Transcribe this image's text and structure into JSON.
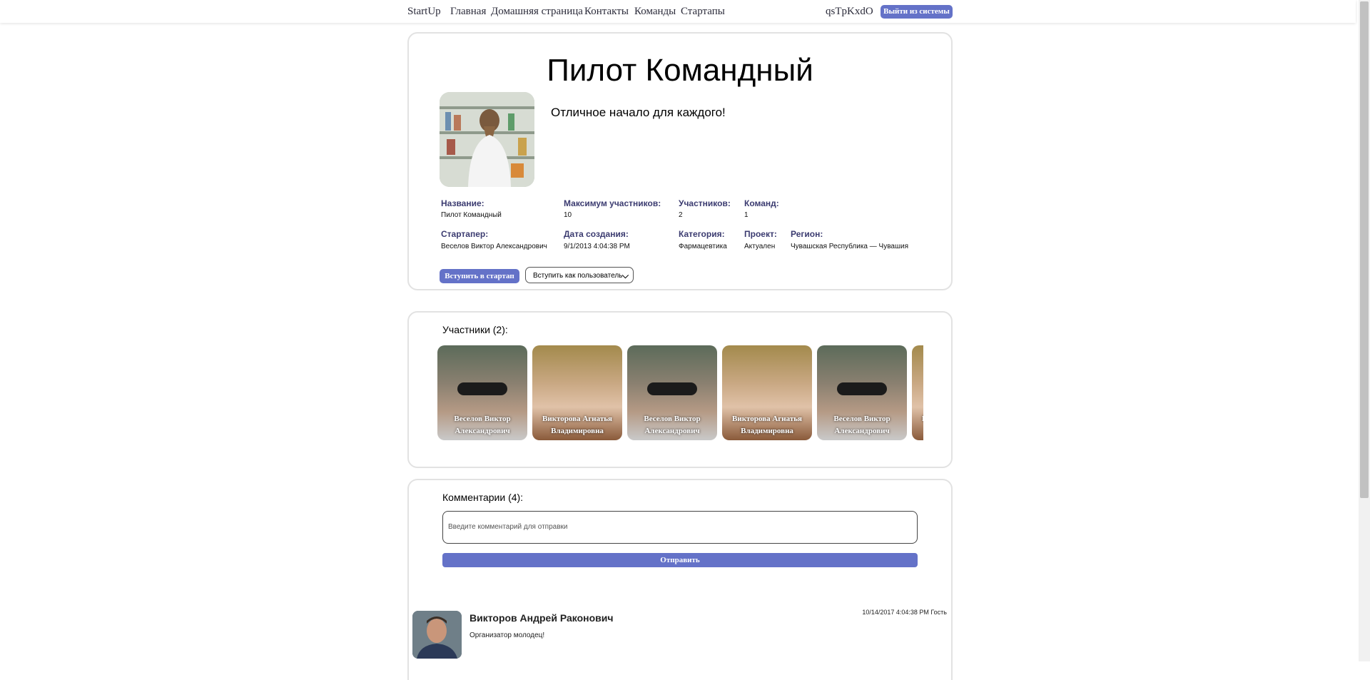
{
  "nav": {
    "brand": "StartUp",
    "links": [
      "Главная",
      "Домашняя страница",
      "Контакты",
      "Команды",
      "Стартапы"
    ],
    "username": "qsTpKxdO",
    "logout": "Выйти из системы"
  },
  "startup": {
    "title": "Пилот Командный",
    "description": "Отличное начало для каждого!",
    "info": {
      "name_label": "Название:",
      "name_value": "Пилот Командный",
      "max_label": "Максимум участников:",
      "max_value": "10",
      "participants_label": "Участников:",
      "participants_value": "2",
      "teams_label": "Команд:",
      "teams_value": "1",
      "starter_label": "Стартапер:",
      "starter_value": "Веселов Виктор Александрович",
      "created_label": "Дата создания:",
      "created_value": "9/1/2013 4:04:38 PM",
      "category_label": "Категория:",
      "category_value": "Фармацевтика",
      "project_label": "Проект:",
      "project_value": "Актуален",
      "region_label": "Регион:",
      "region_value": "Чувашская Республика — Чувашия"
    },
    "join_button": "Вступить в стартап",
    "join_select": "Вступить как пользователь"
  },
  "members": {
    "heading": "Участники (2):",
    "tiles": [
      {
        "name": "Веселов Виктор Александрович"
      },
      {
        "name": "Викторова Агнатья Владимировна"
      },
      {
        "name": "Веселов Виктор Александрович"
      },
      {
        "name": "Викторова Агнатья Владимировна"
      },
      {
        "name": "Веселов Виктор Александрович"
      },
      {
        "name": "Викторова Агнатья Владимировна"
      }
    ]
  },
  "comments": {
    "heading": "Комментарии (4):",
    "input_placeholder": "Введите комментарий для отправки",
    "send_button": "Отправить",
    "items": [
      {
        "author": "Викторов Андрей Раконович",
        "meta": "10/14/2017 4:04:38 PM Гость",
        "text": "Организатор молодец!"
      }
    ]
  },
  "colors": {
    "accent": "#6472c8",
    "label": "#3b3b70"
  }
}
